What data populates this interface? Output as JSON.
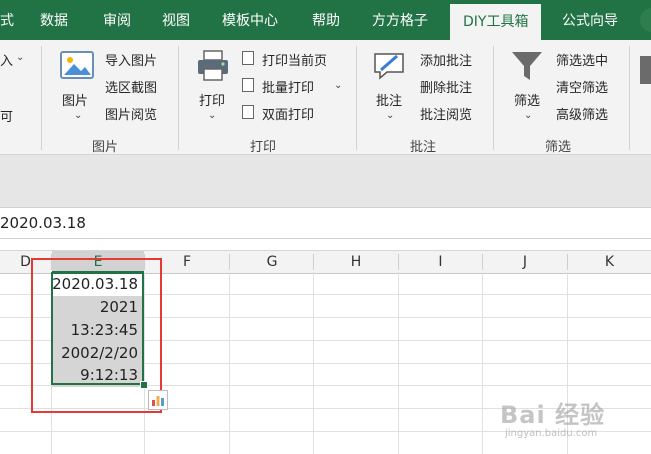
{
  "tabs": [
    {
      "label": "式"
    },
    {
      "label": "数据"
    },
    {
      "label": "审阅"
    },
    {
      "label": "视图"
    },
    {
      "label": "模板中心"
    },
    {
      "label": "帮助"
    },
    {
      "label": "方方格子"
    },
    {
      "label": "DIY工具箱",
      "active": true
    },
    {
      "label": "公式向导"
    }
  ],
  "ribbon": {
    "left_partial": {
      "top": "入",
      "bottom": "可"
    },
    "picture": {
      "big_label": "图片",
      "items": [
        "导入图片",
        "选区截图",
        "图片阅览"
      ],
      "group_label": "图片"
    },
    "print": {
      "big_label": "打印",
      "items": [
        "打印当前页",
        "批量打印",
        "双面打印"
      ],
      "group_label": "打印"
    },
    "comment": {
      "big_label": "批注",
      "items": [
        "添加批注",
        "删除批注",
        "批注阅览"
      ],
      "group_label": "批注"
    },
    "filter": {
      "big_label": "筛选",
      "items": [
        "筛选选中",
        "清空筛选",
        "高级筛选"
      ],
      "group_label": "筛选"
    }
  },
  "formula_bar": {
    "value": "2020.03.18"
  },
  "columns": [
    "D",
    "E",
    "F",
    "G",
    "H",
    "I",
    "J",
    "K"
  ],
  "selected_column": "E",
  "cells": [
    "2020.03.18",
    "2021",
    "13:23:45",
    "2002/2/20",
    "9:12:13"
  ],
  "watermark": {
    "brand": "Bai 经验",
    "url": "jingyan.baidu.com"
  }
}
